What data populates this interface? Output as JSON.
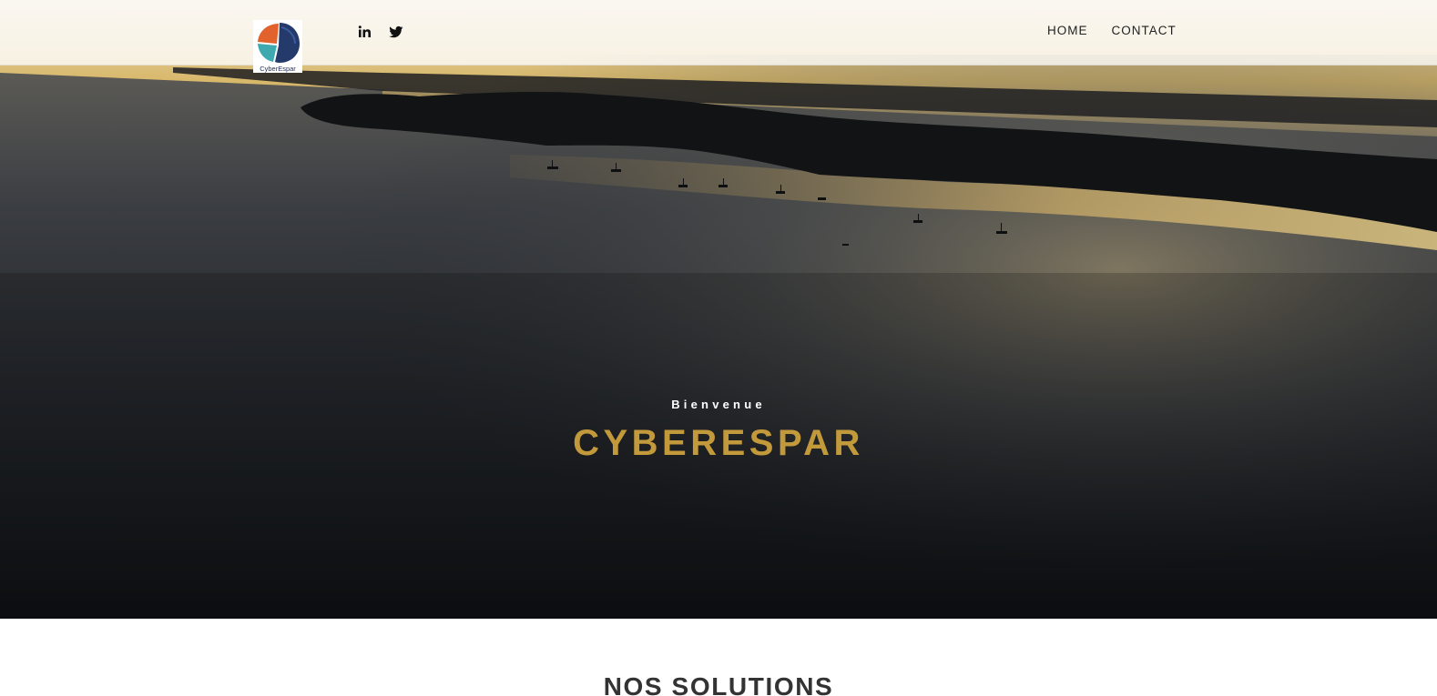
{
  "header": {
    "logo_text": "CyberEspar",
    "social": [
      {
        "name": "linkedin-icon",
        "label": "in"
      },
      {
        "name": "twitter-icon",
        "label": ""
      }
    ],
    "nav": [
      {
        "label": "HOME"
      },
      {
        "label": "CONTACT"
      }
    ]
  },
  "hero": {
    "kicker": "Bienvenue",
    "title": "CYBERESPAR"
  },
  "solutions": {
    "title": "NOS SOLUTIONS"
  },
  "colors": {
    "accent_gold": "#c39a3b",
    "nav_text": "#222222",
    "hero_dark": "#1d2026",
    "section_title": "#333333"
  }
}
